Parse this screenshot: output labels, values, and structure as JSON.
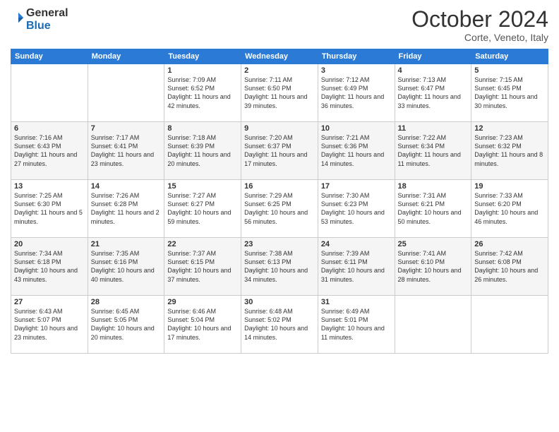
{
  "header": {
    "logo_general": "General",
    "logo_blue": "Blue",
    "month_title": "October 2024",
    "location": "Corte, Veneto, Italy"
  },
  "days_of_week": [
    "Sunday",
    "Monday",
    "Tuesday",
    "Wednesday",
    "Thursday",
    "Friday",
    "Saturday"
  ],
  "weeks": [
    [
      {
        "day": "",
        "info": ""
      },
      {
        "day": "",
        "info": ""
      },
      {
        "day": "1",
        "info": "Sunrise: 7:09 AM\nSunset: 6:52 PM\nDaylight: 11 hours and 42 minutes."
      },
      {
        "day": "2",
        "info": "Sunrise: 7:11 AM\nSunset: 6:50 PM\nDaylight: 11 hours and 39 minutes."
      },
      {
        "day": "3",
        "info": "Sunrise: 7:12 AM\nSunset: 6:49 PM\nDaylight: 11 hours and 36 minutes."
      },
      {
        "day": "4",
        "info": "Sunrise: 7:13 AM\nSunset: 6:47 PM\nDaylight: 11 hours and 33 minutes."
      },
      {
        "day": "5",
        "info": "Sunrise: 7:15 AM\nSunset: 6:45 PM\nDaylight: 11 hours and 30 minutes."
      }
    ],
    [
      {
        "day": "6",
        "info": "Sunrise: 7:16 AM\nSunset: 6:43 PM\nDaylight: 11 hours and 27 minutes."
      },
      {
        "day": "7",
        "info": "Sunrise: 7:17 AM\nSunset: 6:41 PM\nDaylight: 11 hours and 23 minutes."
      },
      {
        "day": "8",
        "info": "Sunrise: 7:18 AM\nSunset: 6:39 PM\nDaylight: 11 hours and 20 minutes."
      },
      {
        "day": "9",
        "info": "Sunrise: 7:20 AM\nSunset: 6:37 PM\nDaylight: 11 hours and 17 minutes."
      },
      {
        "day": "10",
        "info": "Sunrise: 7:21 AM\nSunset: 6:36 PM\nDaylight: 11 hours and 14 minutes."
      },
      {
        "day": "11",
        "info": "Sunrise: 7:22 AM\nSunset: 6:34 PM\nDaylight: 11 hours and 11 minutes."
      },
      {
        "day": "12",
        "info": "Sunrise: 7:23 AM\nSunset: 6:32 PM\nDaylight: 11 hours and 8 minutes."
      }
    ],
    [
      {
        "day": "13",
        "info": "Sunrise: 7:25 AM\nSunset: 6:30 PM\nDaylight: 11 hours and 5 minutes."
      },
      {
        "day": "14",
        "info": "Sunrise: 7:26 AM\nSunset: 6:28 PM\nDaylight: 11 hours and 2 minutes."
      },
      {
        "day": "15",
        "info": "Sunrise: 7:27 AM\nSunset: 6:27 PM\nDaylight: 10 hours and 59 minutes."
      },
      {
        "day": "16",
        "info": "Sunrise: 7:29 AM\nSunset: 6:25 PM\nDaylight: 10 hours and 56 minutes."
      },
      {
        "day": "17",
        "info": "Sunrise: 7:30 AM\nSunset: 6:23 PM\nDaylight: 10 hours and 53 minutes."
      },
      {
        "day": "18",
        "info": "Sunrise: 7:31 AM\nSunset: 6:21 PM\nDaylight: 10 hours and 50 minutes."
      },
      {
        "day": "19",
        "info": "Sunrise: 7:33 AM\nSunset: 6:20 PM\nDaylight: 10 hours and 46 minutes."
      }
    ],
    [
      {
        "day": "20",
        "info": "Sunrise: 7:34 AM\nSunset: 6:18 PM\nDaylight: 10 hours and 43 minutes."
      },
      {
        "day": "21",
        "info": "Sunrise: 7:35 AM\nSunset: 6:16 PM\nDaylight: 10 hours and 40 minutes."
      },
      {
        "day": "22",
        "info": "Sunrise: 7:37 AM\nSunset: 6:15 PM\nDaylight: 10 hours and 37 minutes."
      },
      {
        "day": "23",
        "info": "Sunrise: 7:38 AM\nSunset: 6:13 PM\nDaylight: 10 hours and 34 minutes."
      },
      {
        "day": "24",
        "info": "Sunrise: 7:39 AM\nSunset: 6:11 PM\nDaylight: 10 hours and 31 minutes."
      },
      {
        "day": "25",
        "info": "Sunrise: 7:41 AM\nSunset: 6:10 PM\nDaylight: 10 hours and 28 minutes."
      },
      {
        "day": "26",
        "info": "Sunrise: 7:42 AM\nSunset: 6:08 PM\nDaylight: 10 hours and 26 minutes."
      }
    ],
    [
      {
        "day": "27",
        "info": "Sunrise: 6:43 AM\nSunset: 5:07 PM\nDaylight: 10 hours and 23 minutes."
      },
      {
        "day": "28",
        "info": "Sunrise: 6:45 AM\nSunset: 5:05 PM\nDaylight: 10 hours and 20 minutes."
      },
      {
        "day": "29",
        "info": "Sunrise: 6:46 AM\nSunset: 5:04 PM\nDaylight: 10 hours and 17 minutes."
      },
      {
        "day": "30",
        "info": "Sunrise: 6:48 AM\nSunset: 5:02 PM\nDaylight: 10 hours and 14 minutes."
      },
      {
        "day": "31",
        "info": "Sunrise: 6:49 AM\nSunset: 5:01 PM\nDaylight: 10 hours and 11 minutes."
      },
      {
        "day": "",
        "info": ""
      },
      {
        "day": "",
        "info": ""
      }
    ]
  ]
}
